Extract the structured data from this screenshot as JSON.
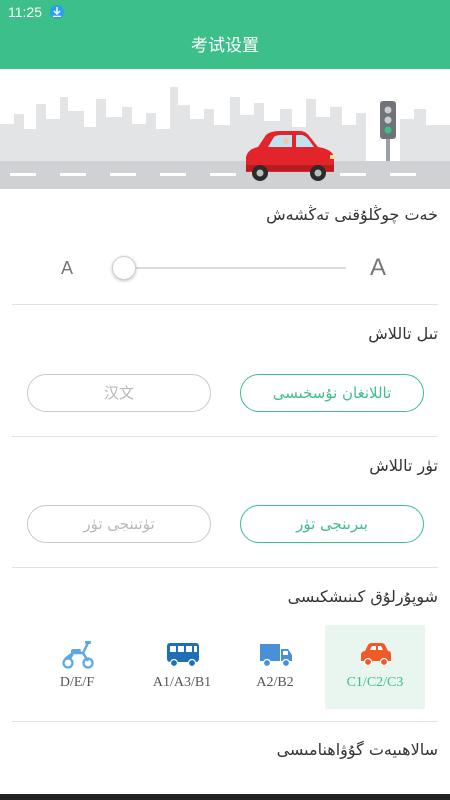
{
  "status_bar": {
    "time": "11:25",
    "download_icon": "download-arrow-icon"
  },
  "header": {
    "title": "考试设置"
  },
  "banner": {
    "description_icon": "car-city-skyline-illustration"
  },
  "font_size": {
    "title": "خەت چوڭلۇقنى تەڭشەش",
    "small_label": "A",
    "large_label": "A",
    "level": 0.0
  },
  "language": {
    "title": "تىل تاللاش",
    "options": [
      {
        "label": "汉文",
        "selected": false
      },
      {
        "label": "تاللانغان نۇسخىسى",
        "selected": true
      }
    ]
  },
  "question_type": {
    "title": "تۈر تاللاش",
    "options": [
      {
        "label": "تۈتىنجى تۈر",
        "selected": false
      },
      {
        "label": "بىرىنجى تۈر",
        "selected": true
      }
    ]
  },
  "license_type": {
    "title": "شوپۇرلۇق كىنىشكىسى",
    "items": [
      {
        "label": "D/E/F",
        "icon": "scooter-icon",
        "color": "#5aa9e6",
        "selected": false
      },
      {
        "label": "A1/A3/B1",
        "icon": "bus-icon",
        "color": "#1f6fb8",
        "selected": false
      },
      {
        "label": "A2/B2",
        "icon": "truck-icon",
        "color": "#4a90d9",
        "selected": false
      },
      {
        "label": "C1/C2/C3",
        "icon": "car-icon",
        "color": "#f05a28",
        "selected": true
      }
    ]
  },
  "settings_more": {
    "title": "سالاھىيەت گۇۋاھنامىسى"
  },
  "colors": {
    "accent": "#3dbf8a",
    "divider": "#e2e2e2",
    "selected_bg": "#e8f6ef"
  }
}
